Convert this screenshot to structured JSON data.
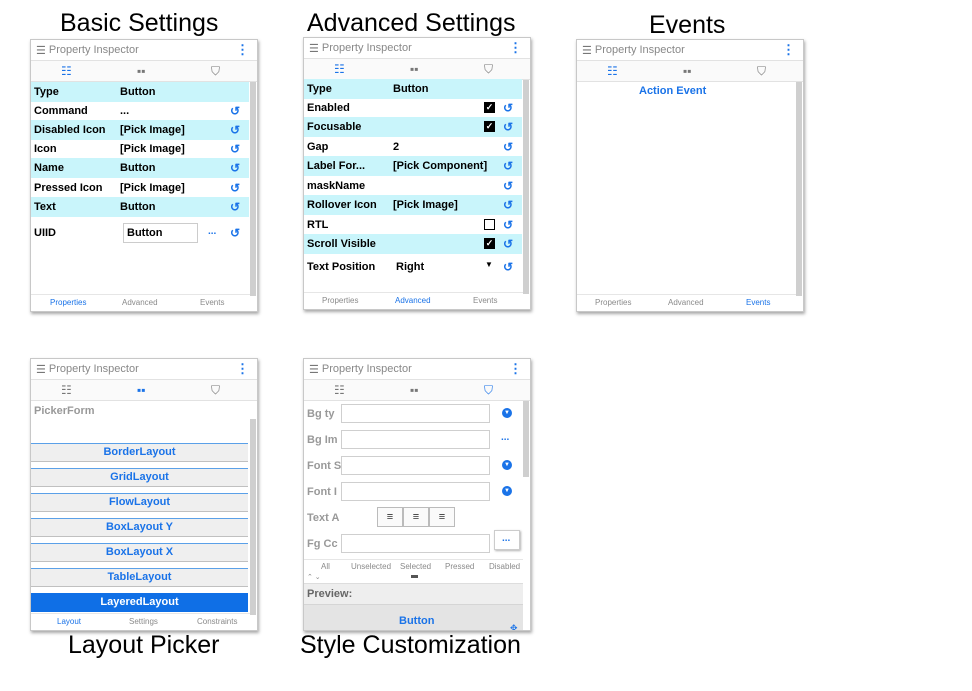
{
  "captions": {
    "basic": "Basic Settings",
    "advanced": "Advanced Settings",
    "events": "Events",
    "layout": "Layout Picker",
    "style": "Style Customization"
  },
  "panel_title": "Property Inspector",
  "menu_glyph": "⋮",
  "tabs": {
    "properties": "Properties",
    "advanced": "Advanced",
    "events": "Events"
  },
  "basic": {
    "rows": [
      {
        "label": "Type",
        "value": "Button"
      },
      {
        "label": "Command",
        "value": "..."
      },
      {
        "label": "Disabled Icon",
        "value": "[Pick Image]"
      },
      {
        "label": "Icon",
        "value": "[Pick Image]"
      },
      {
        "label": "Name",
        "value": "Button"
      },
      {
        "label": "Pressed Icon",
        "value": "[Pick Image]"
      },
      {
        "label": "Text",
        "value": "Button"
      }
    ],
    "uiid_label": "UIID",
    "uiid_value": "Button",
    "uiid_more": "..."
  },
  "advanced": {
    "rows": [
      {
        "label": "Type",
        "value": "Button"
      },
      {
        "label": "Enabled",
        "value": ""
      },
      {
        "label": "Focusable",
        "value": ""
      },
      {
        "label": "Gap",
        "value": "2"
      },
      {
        "label": "Label For...",
        "value": "[Pick Component]"
      },
      {
        "label": "maskName",
        "value": ""
      },
      {
        "label": "Rollover Icon",
        "value": "[Pick Image]"
      },
      {
        "label": "RTL",
        "value": ""
      },
      {
        "label": "Scroll Visible",
        "value": ""
      },
      {
        "label": "Text Position",
        "value": "Right"
      }
    ],
    "checkbox_states": {
      "enabled": true,
      "focusable": true,
      "rtl": false,
      "scroll_visible": true
    }
  },
  "events": {
    "action_event": "Action Event"
  },
  "layout_picker": {
    "header": "PickerForm",
    "layouts": [
      "BorderLayout",
      "GridLayout",
      "FlowLayout",
      "BoxLayout Y",
      "BoxLayout X",
      "TableLayout",
      "LayeredLayout"
    ],
    "selected": "LayeredLayout",
    "tabs": {
      "layout": "Layout",
      "settings": "Settings",
      "constraints": "Constraints"
    }
  },
  "style": {
    "fields": [
      "Bg ty",
      "Bg Im",
      "Font S",
      "Font I",
      "Text A",
      "Fg Cc"
    ],
    "states": [
      "All",
      "Unselected",
      "Selected",
      "Pressed",
      "Disabled"
    ],
    "preview_label": "Preview:",
    "preview_button": "Button",
    "more": "..."
  },
  "accent_color": "#1a73e8",
  "highlight_color": "#c9f5fb"
}
